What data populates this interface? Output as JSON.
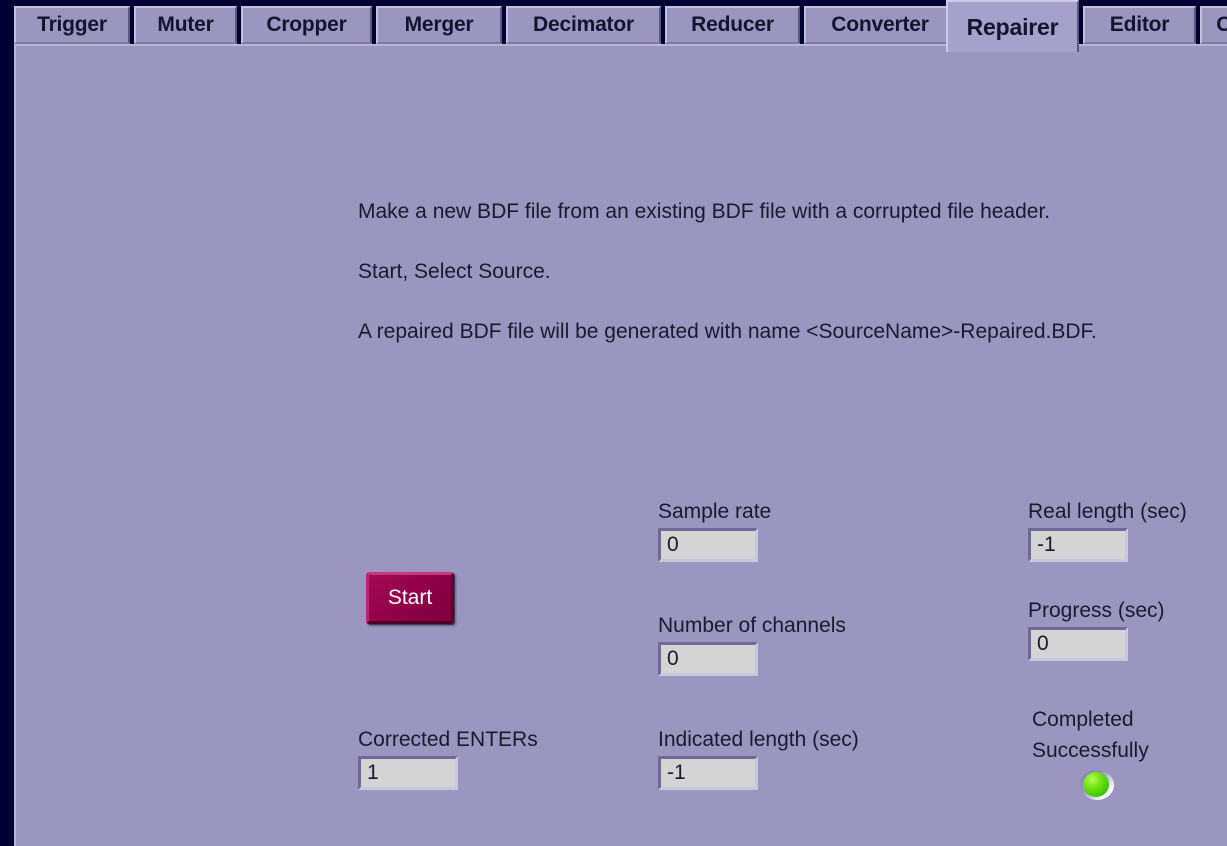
{
  "window": {
    "background_color": "#000033",
    "pane_color": "#9a96c0"
  },
  "tabs": {
    "selected": "Repairer",
    "items": [
      {
        "label": "Trigger",
        "selected": false
      },
      {
        "label": "Muter",
        "selected": false
      },
      {
        "label": "Cropper",
        "selected": false
      },
      {
        "label": "Merger",
        "selected": false
      },
      {
        "label": "Decimator",
        "selected": false
      },
      {
        "label": "Reducer",
        "selected": false
      },
      {
        "label": "Converter",
        "selected": false
      },
      {
        "label": "Repairer",
        "selected": true
      },
      {
        "label": "Editor",
        "selected": false
      },
      {
        "label": "Co",
        "selected": false
      }
    ]
  },
  "description": {
    "line1": "Make a new BDF file from an existing BDF file with a corrupted file header.",
    "line2": "Start, Select Source.",
    "line3": "A repaired BDF file will be generated with name <SourceName>-Repaired.BDF."
  },
  "start_button": {
    "label": "Start",
    "color": "#93004a",
    "text_color": "#ffffff"
  },
  "indicators": {
    "sample_rate": {
      "label": "Sample rate",
      "value": "0"
    },
    "number_of_channels": {
      "label": "Number of channels",
      "value": "0"
    },
    "corrected_enters": {
      "label": "Corrected ENTERs",
      "value": "1"
    },
    "indicated_length": {
      "label": "Indicated length (sec)",
      "value": "-1"
    },
    "real_length": {
      "label": "Real length (sec)",
      "value": "-1"
    },
    "progress": {
      "label": "Progress (sec)",
      "value": "0"
    }
  },
  "status_led": {
    "label_line1": "Completed",
    "label_line2": "Successfully",
    "state": "on",
    "color": "#5ad513"
  }
}
